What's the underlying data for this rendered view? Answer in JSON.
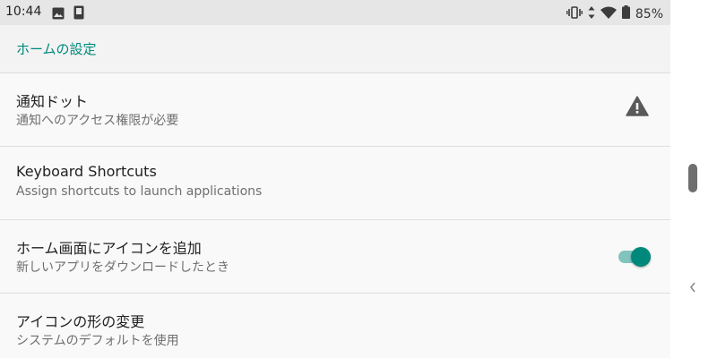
{
  "status_bar": {
    "time": "10:44",
    "battery_percent": "85%",
    "icons": [
      "image-icon",
      "phone-icon",
      "vibrate-icon",
      "data-arrows-icon",
      "wifi-icon",
      "battery-icon"
    ]
  },
  "toolbar": {
    "title": "ホームの設定"
  },
  "preferences": [
    {
      "title": "通知ドット",
      "summary": "通知へのアクセス権限が必要",
      "widget": "warning-icon"
    },
    {
      "title": "Keyboard Shortcuts",
      "summary": "Assign shortcuts to launch applications"
    },
    {
      "title": "ホーム画面にアイコンを追加",
      "summary": "新しいアプリをダウンロードしたとき",
      "widget": "toggle",
      "toggle_on": true
    },
    {
      "title": "アイコンの形の変更",
      "summary": "システムのデフォルトを使用"
    }
  ],
  "colors": {
    "accent": "#00897b",
    "toggle_track": "#80c4bd",
    "status_bar": "#e6e6e6",
    "toolbar": "#f3f3f3",
    "background": "#f9f9f9"
  }
}
